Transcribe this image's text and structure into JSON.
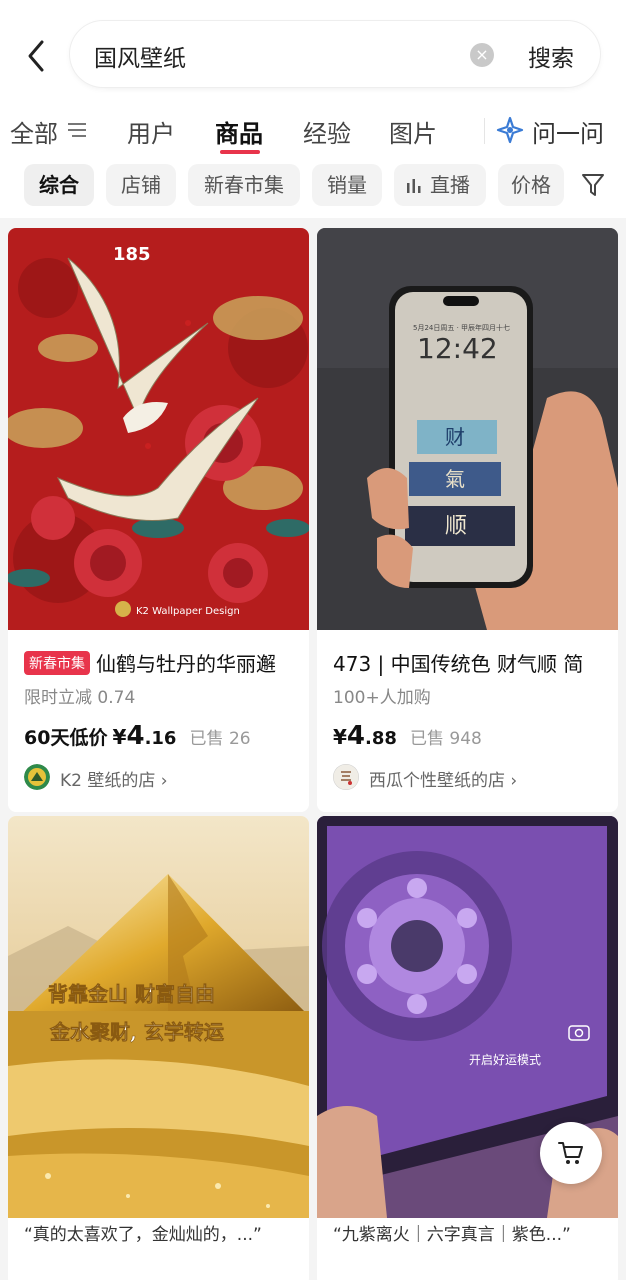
{
  "search": {
    "query": "国风壁纸",
    "button": "搜索"
  },
  "tabs": [
    {
      "label": "全部"
    },
    {
      "label": "用户"
    },
    {
      "label": "商品"
    },
    {
      "label": "经验"
    },
    {
      "label": "图片"
    }
  ],
  "ask": {
    "label": "问一问"
  },
  "chips": [
    {
      "label": "综合"
    },
    {
      "label": "店铺"
    },
    {
      "label": "新春市集"
    },
    {
      "label": "销量"
    },
    {
      "label": "直播"
    },
    {
      "label": "价格"
    }
  ],
  "products": [
    {
      "image_text": {
        "top": "185",
        "brand": "K2 Wallpaper Design"
      },
      "badge": "新春市集",
      "title": "仙鹤与牡丹的华丽邂",
      "subtitle": "限时立减 0.74",
      "price_prefix": "60天低价",
      "price_symbol": "¥",
      "price_int": "4",
      "price_dec": ".16",
      "sold": "已售 26",
      "shop": "K2 壁纸的店 ›"
    },
    {
      "image_text": {
        "time": "12:42",
        "date": "5月24日周五 · 甲辰年四月十七",
        "c1": "财",
        "c2": "氣",
        "c3": "顺"
      },
      "title": "473 | 中国传统色 财气顺 简",
      "subtitle": "100+人加购",
      "price_symbol": "¥",
      "price_int": "4",
      "price_dec": ".88",
      "sold": "已售 948",
      "shop": "西瓜个性壁纸的店 ›"
    },
    {
      "image_text": {
        "line1": "背靠金山 财富自由",
        "line2": "金水聚财, 玄学转运"
      },
      "quote": "“真的太喜欢了，金灿灿的，...”"
    },
    {
      "image_text": {
        "mode": "开启好运模式"
      },
      "quote": "“九紫离火｜六字真言｜紫色...”"
    }
  ],
  "colors": {
    "accent": "#e8344b",
    "bg": "#f4f4f4"
  }
}
